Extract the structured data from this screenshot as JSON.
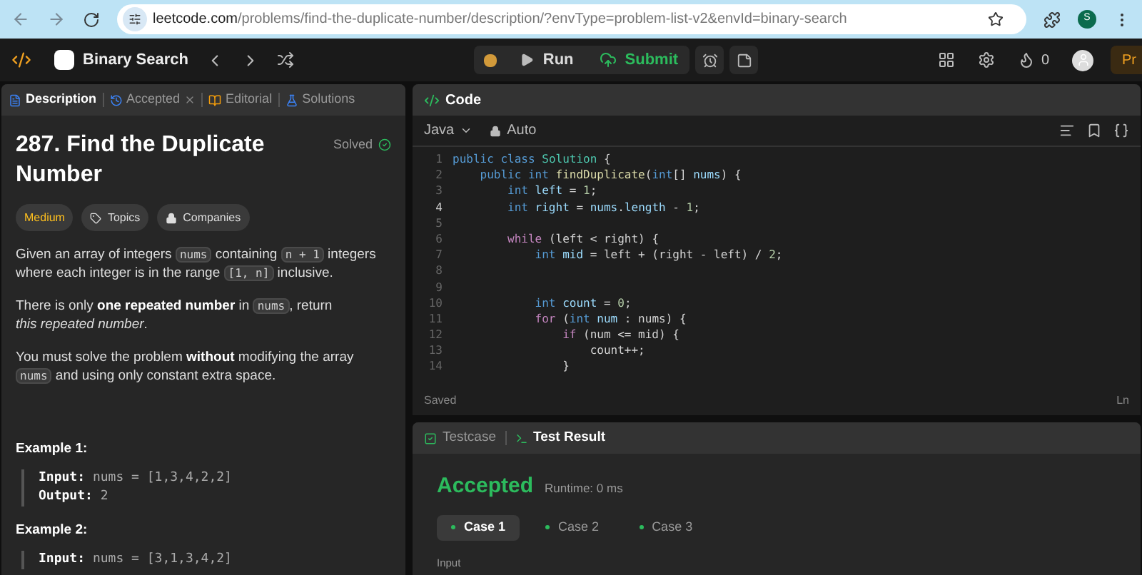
{
  "browser": {
    "url_host": "leetcode.com",
    "url_path": "/problems/find-the-duplicate-number/description/?envType=problem-list-v2&envId=binary-search",
    "profile_initial": "S"
  },
  "header": {
    "list_title": "Binary Search",
    "run": "Run",
    "submit": "Submit",
    "streak": "0",
    "premium": "Pr"
  },
  "left_tabs": [
    {
      "label": "Description",
      "selected": true,
      "closable": false
    },
    {
      "label": "Accepted",
      "selected": false,
      "closable": true
    },
    {
      "label": "Editorial",
      "selected": false,
      "closable": false
    },
    {
      "label": "Solutions",
      "selected": false,
      "closable": false
    }
  ],
  "problem": {
    "title": "287. Find the Duplicate Number",
    "status": "Solved",
    "difficulty": "Medium",
    "tags": [
      "Topics",
      "Companies"
    ],
    "paragraphs": [
      [
        {
          "kind": "text",
          "text": "Given an array of integers "
        },
        {
          "kind": "code",
          "text": "nums"
        },
        {
          "kind": "text",
          "text": " containing "
        },
        {
          "kind": "code",
          "text": "n + 1"
        },
        {
          "kind": "text",
          "text": " integers where each integer is in the range "
        },
        {
          "kind": "code",
          "text": "[1, n]"
        },
        {
          "kind": "text",
          "text": " inclusive."
        }
      ],
      [
        {
          "kind": "text",
          "text": "There is only "
        },
        {
          "kind": "bold",
          "text": "one repeated number"
        },
        {
          "kind": "text",
          "text": " in "
        },
        {
          "kind": "code",
          "text": "nums"
        },
        {
          "kind": "text",
          "text": ", return"
        },
        {
          "kind": "italic",
          "text": "this repeated number",
          "line_break": true
        },
        {
          "kind": "text",
          "text": "."
        }
      ],
      [
        {
          "kind": "text",
          "text": "You must solve the problem "
        },
        {
          "kind": "bold",
          "text": "without"
        },
        {
          "kind": "text",
          "text": " modifying the array "
        },
        {
          "kind": "code",
          "text": "nums"
        },
        {
          "kind": "text",
          "text": " and using only constant extra space."
        }
      ]
    ],
    "examples": [
      {
        "title": "Example 1:",
        "lines": [
          {
            "label": "Input:",
            "value": "nums = [1,3,4,2,2]"
          },
          {
            "label": "Output:",
            "value": "2"
          }
        ]
      },
      {
        "title": "Example 2:",
        "lines": [
          {
            "label": "Input:",
            "value": "nums = [3,1,3,4,2]"
          }
        ]
      }
    ]
  },
  "code_panel": {
    "title": "Code",
    "language": "Java",
    "mode": "Auto",
    "status": "Saved",
    "cursor": "Ln",
    "lines": [
      {
        "number": "1",
        "current": false,
        "tokens": [
          {
            "kind": "kw",
            "text": "public class "
          },
          {
            "kind": "type",
            "text": "Solution"
          },
          {
            "kind": "plain",
            "text": " {"
          }
        ]
      },
      {
        "number": "2",
        "current": false,
        "tokens": [
          {
            "kind": "kw",
            "text": "    public int "
          },
          {
            "kind": "fn",
            "text": "findDuplicate"
          },
          {
            "kind": "plain",
            "text": "("
          },
          {
            "kind": "kw",
            "text": "int"
          },
          {
            "kind": "plain",
            "text": "[] "
          },
          {
            "kind": "var",
            "text": "nums"
          },
          {
            "kind": "plain",
            "text": ") {"
          }
        ]
      },
      {
        "number": "3",
        "current": false,
        "tokens": [
          {
            "kind": "kw",
            "text": "        int "
          },
          {
            "kind": "var",
            "text": "left"
          },
          {
            "kind": "plain",
            "text": " = "
          },
          {
            "kind": "num",
            "text": "1"
          },
          {
            "kind": "plain",
            "text": ";"
          }
        ]
      },
      {
        "number": "4",
        "current": true,
        "tokens": [
          {
            "kind": "kw",
            "text": "        int "
          },
          {
            "kind": "var",
            "text": "right"
          },
          {
            "kind": "plain",
            "text": " = "
          },
          {
            "kind": "var",
            "text": "nums"
          },
          {
            "kind": "plain",
            "text": "."
          },
          {
            "kind": "var",
            "text": "length"
          },
          {
            "kind": "plain",
            "text": " - "
          },
          {
            "kind": "num",
            "text": "1"
          },
          {
            "kind": "plain",
            "text": ";"
          }
        ]
      },
      {
        "number": "5",
        "current": false
      },
      {
        "number": "6",
        "current": false,
        "tokens": [
          {
            "kind": "ctrl",
            "text": "        while"
          },
          {
            "kind": "plain",
            "text": " (left < right) {"
          }
        ]
      },
      {
        "number": "7",
        "current": false,
        "tokens": [
          {
            "kind": "kw",
            "text": "            int "
          },
          {
            "kind": "var",
            "text": "mid"
          },
          {
            "kind": "plain",
            "text": " = left + (right - left) / "
          },
          {
            "kind": "num",
            "text": "2"
          },
          {
            "kind": "plain",
            "text": ";"
          }
        ]
      },
      {
        "number": "8",
        "current": false
      },
      {
        "number": "9",
        "current": false
      },
      {
        "number": "10",
        "current": false,
        "tokens": [
          {
            "kind": "kw",
            "text": "            int "
          },
          {
            "kind": "var",
            "text": "count"
          },
          {
            "kind": "plain",
            "text": " = "
          },
          {
            "kind": "num",
            "text": "0"
          },
          {
            "kind": "plain",
            "text": ";"
          }
        ]
      },
      {
        "number": "11",
        "current": false,
        "tokens": [
          {
            "kind": "ctrl",
            "text": "            for"
          },
          {
            "kind": "plain",
            "text": " ("
          },
          {
            "kind": "kw",
            "text": "int "
          },
          {
            "kind": "var",
            "text": "num"
          },
          {
            "kind": "plain",
            "text": " : nums) {"
          }
        ]
      },
      {
        "number": "12",
        "current": false,
        "tokens": [
          {
            "kind": "ctrl",
            "text": "                if"
          },
          {
            "kind": "plain",
            "text": " (num <= mid) {"
          }
        ]
      },
      {
        "number": "13",
        "current": false,
        "tokens": [
          {
            "kind": "plain",
            "text": "                    count++;"
          }
        ]
      },
      {
        "number": "14",
        "current": false,
        "tokens": [
          {
            "kind": "plain",
            "text": "                }"
          }
        ]
      }
    ]
  },
  "result_panel": {
    "tabs": [
      {
        "label": "Testcase",
        "selected": false
      },
      {
        "label": "Test Result",
        "selected": true
      }
    ],
    "verdict": "Accepted",
    "runtime": "Runtime: 0 ms",
    "cases": [
      {
        "label": "Case 1",
        "selected": true
      },
      {
        "label": "Case 2",
        "selected": false
      },
      {
        "label": "Case 3",
        "selected": false
      }
    ],
    "input_label": "Input"
  }
}
